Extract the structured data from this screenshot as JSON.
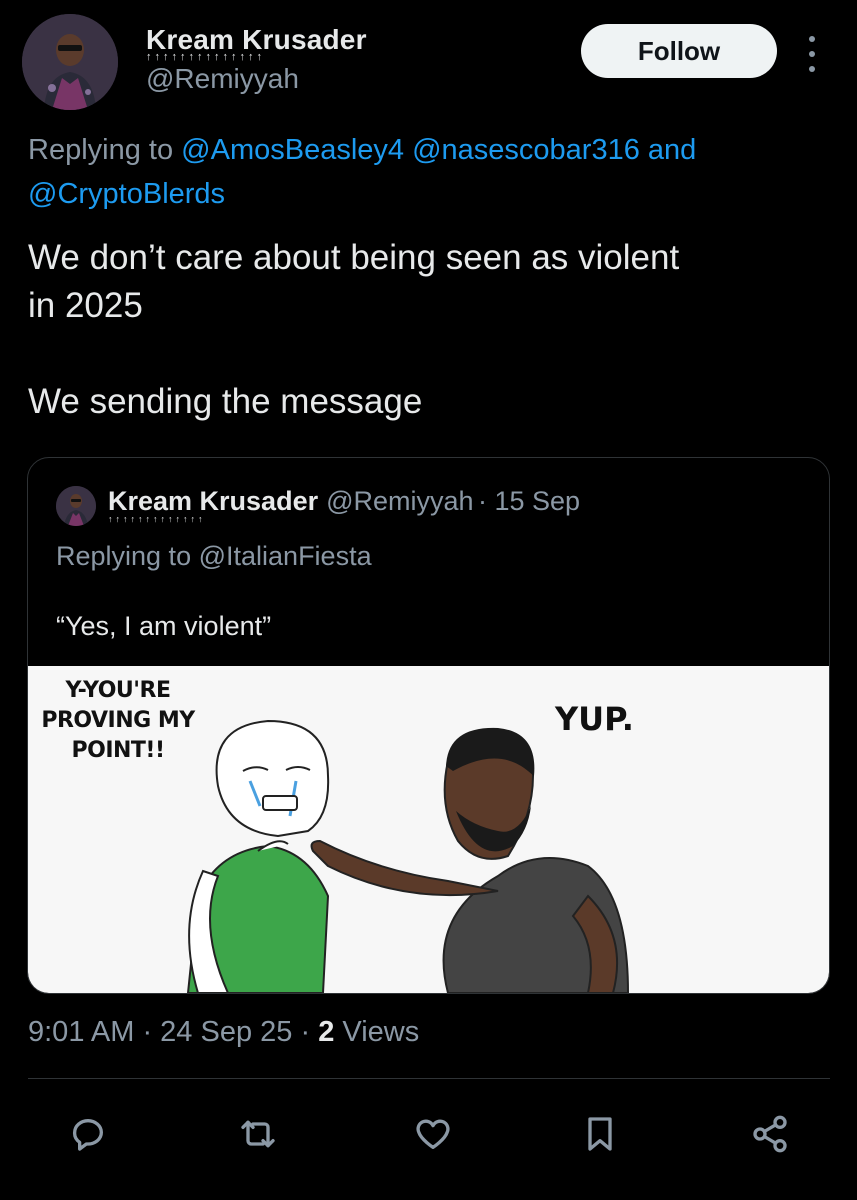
{
  "author": {
    "display_name": "Kream Krusader",
    "deco": "↑↑↑↑↑↑↑↑↑↑↑↑↑↑",
    "handle": "@Remiyyah"
  },
  "follow_label": "Follow",
  "reply_to": {
    "prefix": "Replying to",
    "mentions": [
      "@AmosBeasley4",
      "@nasescobar316",
      "@CryptoBlerds"
    ],
    "joiner": "and"
  },
  "tweet": {
    "line1": "We don’t care about being seen as violent",
    "line2": "in 2025",
    "line3": "We sending the message"
  },
  "quoted": {
    "display_name": "Kream Krusader",
    "deco": "↑↑↑↑↑↑↑↑↑↑↑↑↑",
    "handle": "@Remiyyah",
    "date": "· 15 Sep",
    "reply_prefix": "Replying to",
    "reply_mention": "@ItalianFiesta",
    "text": "“Yes, I am violent”",
    "meme": {
      "left_line1": "Y-YOU'RE",
      "left_line2": "PROVING MY",
      "left_line3": "POINT!!",
      "right_text": "YUP."
    }
  },
  "timestamp": {
    "time": "9:01 AM",
    "date": "· 24 Sep 25 ·",
    "views_count": "2",
    "views_label": "Views"
  },
  "actions": [
    {
      "icon": "reply-icon"
    },
    {
      "icon": "retweet-icon"
    },
    {
      "icon": "like-icon"
    },
    {
      "icon": "bookmark-icon"
    },
    {
      "icon": "share-icon"
    }
  ],
  "colors": {
    "background": "#000000",
    "text": "#e7e9ea",
    "secondary": "#8b98a5",
    "link": "#1d9bf0",
    "border": "#2f3336"
  }
}
